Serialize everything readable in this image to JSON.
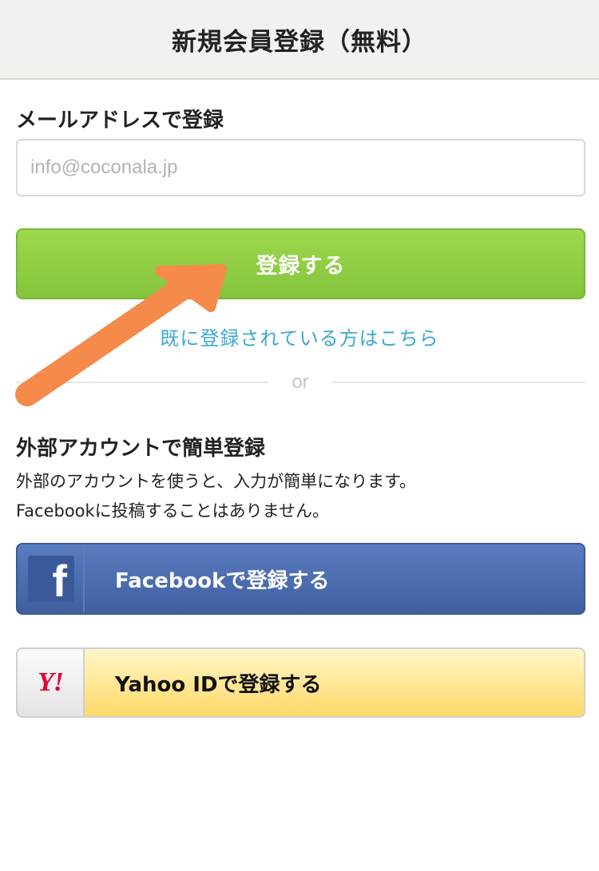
{
  "header": {
    "title": "新規会員登録（無料）"
  },
  "email_section": {
    "heading": "メールアドレスで登録",
    "input_placeholder": "info@coconala.jp",
    "input_value": ""
  },
  "register_button": {
    "label": "登録する",
    "color": "#8cc941"
  },
  "login_link": {
    "label": "既に登録されている方はこちら",
    "color": "#3aa9d4"
  },
  "divider": {
    "label": "or"
  },
  "external_section": {
    "heading": "外部アカウントで簡単登録",
    "description_line1": "外部のアカウントを使うと、入力が簡単になります。",
    "description_line2": "Facebookに投稿することはありません。"
  },
  "facebook_button": {
    "label": "Facebookで登録する",
    "icon": "facebook-icon",
    "icon_glyph": "f",
    "color": "#4a69ad"
  },
  "yahoo_button": {
    "label": "Yahoo IDで登録する",
    "icon": "yahoo-logo-icon",
    "icon_glyph": "Y!",
    "color": "#ffdf7a"
  },
  "annotation": {
    "icon": "orange-arrow-icon",
    "color": "#f58a4b"
  }
}
